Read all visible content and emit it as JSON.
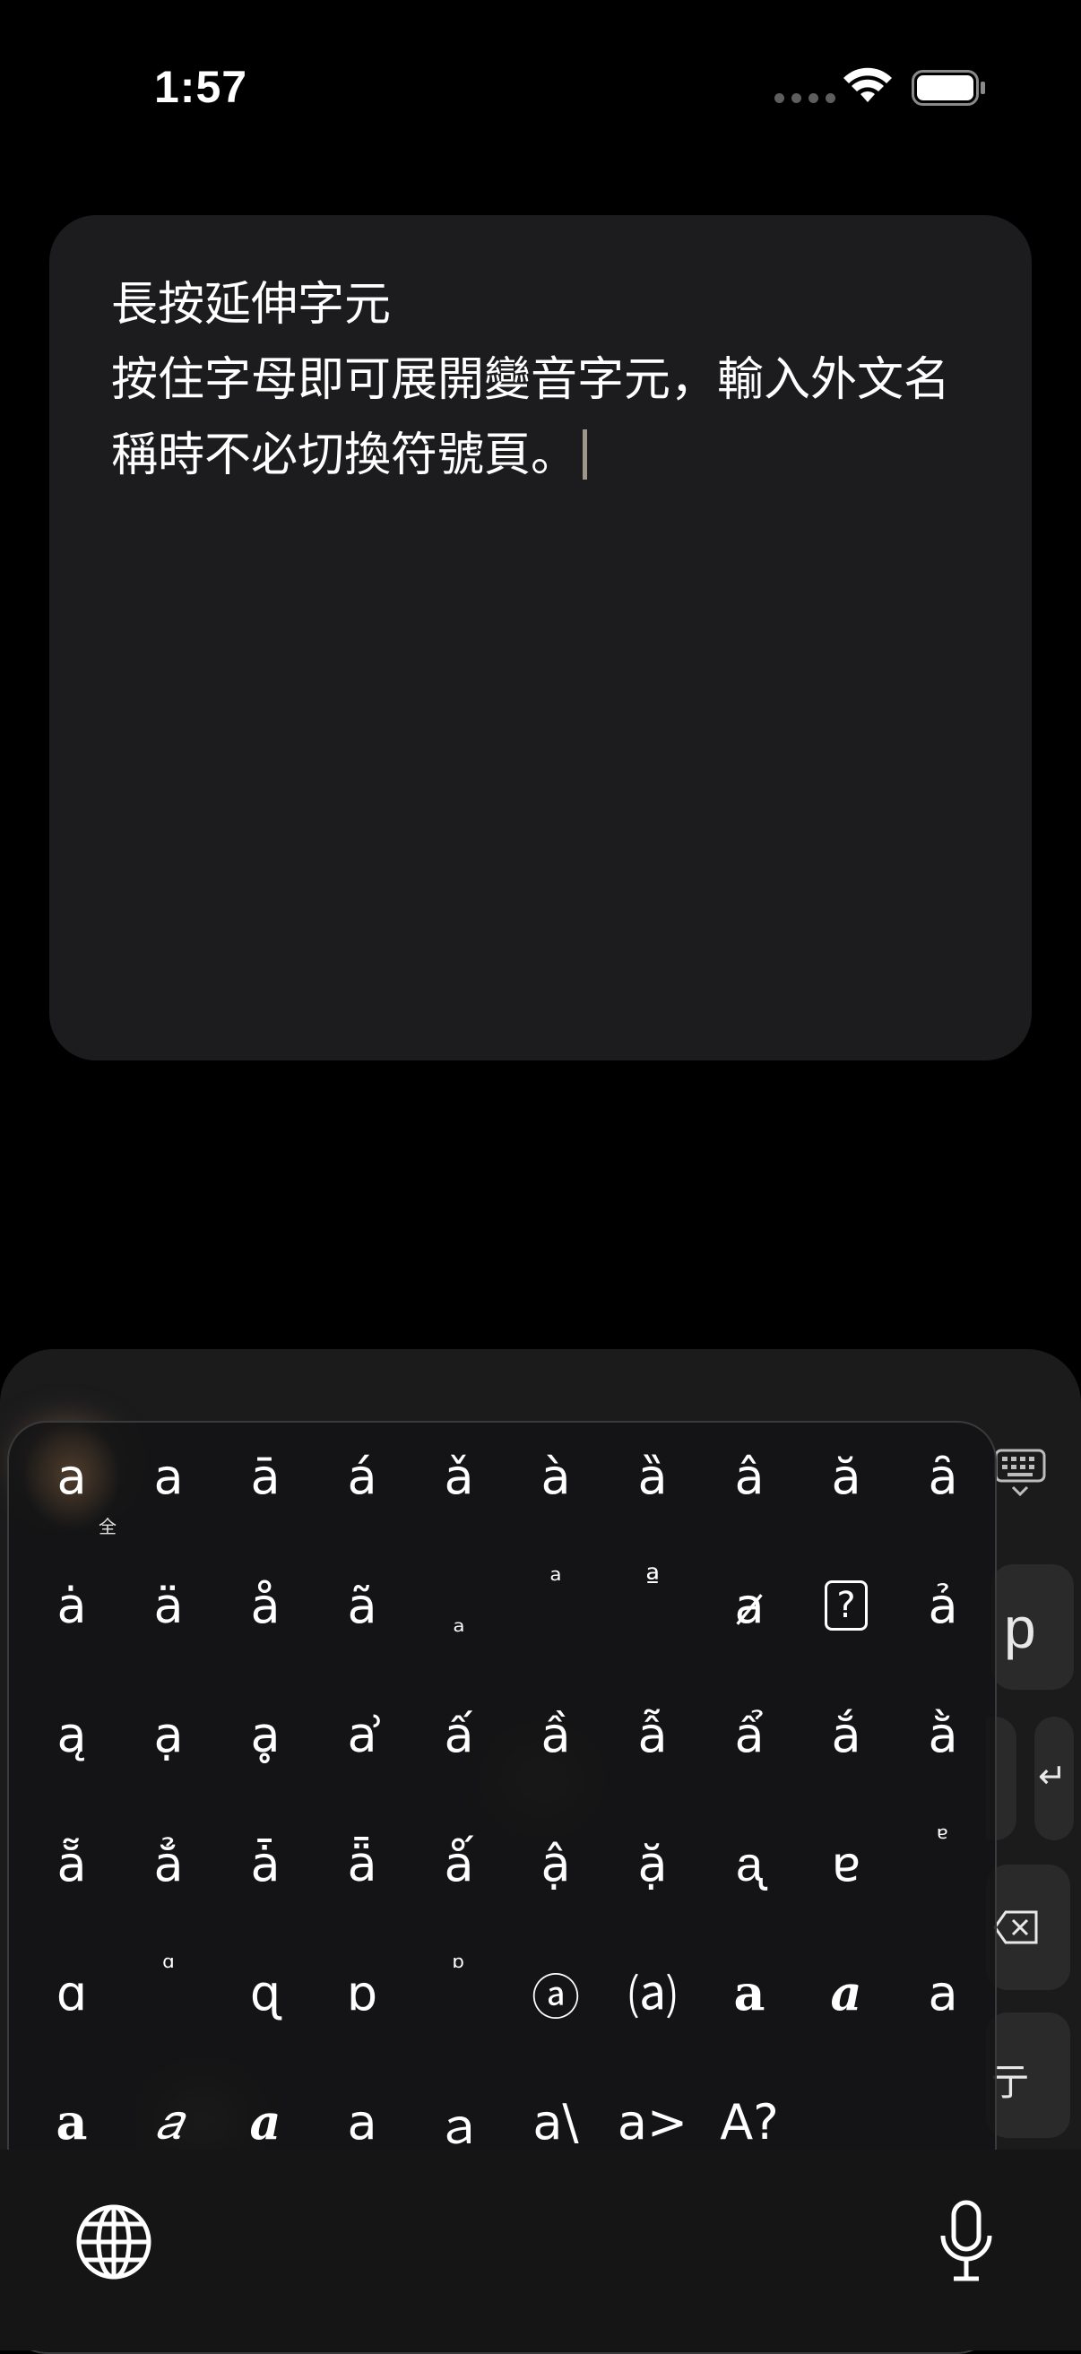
{
  "status_bar": {
    "time": "1:57"
  },
  "note": {
    "text": "長按延伸字元\n按住字母即可展開變音字元，輸入外文名稱時不必切換符號頁。"
  },
  "keyboard": {
    "visible_keys": {
      "p": "p",
      "enter_symbol": "↵",
      "line_key_fragment": "亍"
    },
    "accent_popup": {
      "rows": [
        [
          "a",
          "a",
          "ā",
          "á",
          "ǎ",
          "à",
          "ȁ",
          "â",
          "ă",
          "ȃ"
        ],
        [
          "ȧ",
          "ä",
          "å",
          "ã",
          "ₐ",
          "ᵃ",
          "ª",
          "ⱥ",
          "?",
          "ả"
        ],
        [
          "ą",
          "ạ",
          "ḁ",
          "ẚ",
          "ấ",
          "ầ",
          "ẫ",
          "ẩ",
          "ắ",
          "ằ"
        ],
        [
          "ẵ",
          "ẳ",
          "ǡ",
          "ǟ",
          "ǻ",
          "ậ",
          "ặ",
          "ᶏ",
          "ɐ",
          "ᵄ"
        ],
        [
          "ɑ",
          "ᵅ",
          "ɋ",
          "ɒ",
          "ᶛ",
          "ⓐ",
          "⒜",
          "𝐚",
          "𝒂",
          "a"
        ],
        [
          "𝐚",
          "𝑎",
          "𝒂",
          "a",
          "ａ",
          "a\\",
          "a>",
          "A?"
        ]
      ],
      "fullwidth_tag": "全"
    }
  }
}
